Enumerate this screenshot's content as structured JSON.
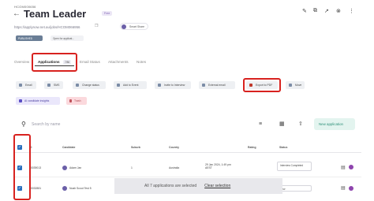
{
  "header": {
    "code": "HCOM000656",
    "title": "Team Leader",
    "plan_badge": "Free",
    "url": "https://applynow.net.au/jobs/HCOM066956",
    "user_name": "Smart Share",
    "published": "PUBLISHED",
    "open_for": "Open for applicat..."
  },
  "tabs": [
    "Overview",
    "Applications",
    "Email Status",
    "Attachments",
    "Notes"
  ],
  "applications_count": "7/86",
  "actions": {
    "row1": [
      "Email",
      "SMS",
      "Change status",
      "Add to Event",
      "Invite to Interview",
      "External email",
      "Export to PDF",
      "Move"
    ],
    "ai_insights": "AI candidate insights",
    "trash": "Trash"
  },
  "search": {
    "placeholder": "Search by name"
  },
  "new_application": "New application",
  "columns": [
    "ID",
    "Candidate",
    "Suburb",
    "Country",
    "Rating",
    "Status"
  ],
  "rows": [
    {
      "id": "10039013",
      "candidate": "Adam Jan",
      "suburb": "1",
      "country": "Australia",
      "date": "29 Jan 2024, 1:49 pm AEST",
      "status": "Interview Completed"
    },
    {
      "id": "10032881",
      "candidate": "Noah Scout Test 5",
      "suburb": "",
      "country": "",
      "date": "",
      "status": "New"
    }
  ],
  "selection_bar": {
    "text": "All 7 applications are selected",
    "clear": "Clear selection"
  },
  "colors": {
    "accent": "#2a6fbd",
    "highlight": "#d8221f",
    "brand_green": "#2c8f78"
  }
}
